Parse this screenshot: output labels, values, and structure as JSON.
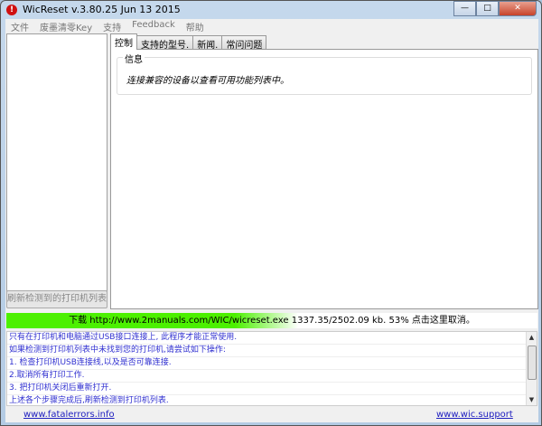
{
  "window": {
    "title": "WicReset v.3.80.25 Jun 13 2015",
    "app_icon": "!",
    "minimize": "—",
    "maximize": "□",
    "close": "✕"
  },
  "menu": [
    "文件",
    "废墨清零Key",
    "支持",
    "Feedback",
    "帮助"
  ],
  "left": {
    "refresh_button": "刷新检测到的打印机列表"
  },
  "tabs": [
    "控制",
    "支持的型号.",
    "新闻.",
    "常问问题"
  ],
  "info": {
    "group_label": "信息",
    "message": "连接兼容的设备以查看可用功能列表中。"
  },
  "download": {
    "text": "下载 http://www.2manuals.com/WIC/wicreset.exe 1337.35/2502.09 kb. 53% 点击这里取消。",
    "progress_percent": 53
  },
  "log": [
    "只有在打印机和电脑通过USB接口连接上, 此程序才能正常使用.",
    "如果检测到打印机列表中未找到您的打印机,请尝试如下操作:",
    "1. 检查打印机USB连接线,以及是否可靠连接.",
    "2.取消所有打印工作.",
    "3. 把打印机关闭后重新打开.",
    "上述各个步骤完成后,刷新检测到打印机列表."
  ],
  "footer": {
    "left_link": "www.fatalerrors.info",
    "right_link": "www.wic.support"
  }
}
